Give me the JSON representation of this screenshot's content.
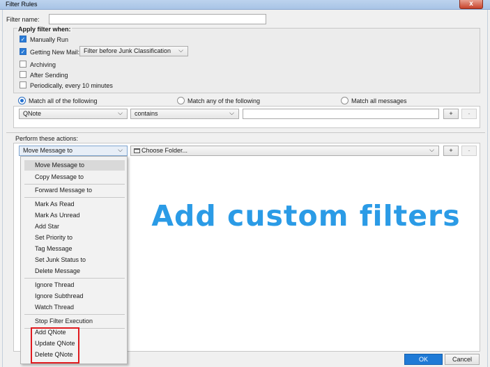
{
  "window": {
    "title": "Filter Rules",
    "close_glyph": "x"
  },
  "filter_name": {
    "label": "Filter name:",
    "mnemonic": "i",
    "value": ""
  },
  "apply_when": {
    "heading": "Apply filter when:",
    "manually_run": {
      "label": "Manually Run",
      "checked": true
    },
    "getting_new_mail": {
      "label": "Getting New Mail:",
      "checked": true,
      "timing": "Filter before Junk Classification"
    },
    "archiving": {
      "label": "Archiving",
      "checked": false
    },
    "after_sending": {
      "label": "After Sending",
      "checked": false
    },
    "periodically": {
      "label": "Periodically, every 10 minutes",
      "checked": false
    }
  },
  "match": {
    "all": "Match all of the following",
    "any": "Match any of the following",
    "all_messages": "Match all messages",
    "selected": "all"
  },
  "condition": {
    "field": "QNote",
    "operator": "contains",
    "value": "",
    "add": "+",
    "remove": "-"
  },
  "actions": {
    "label": "Perform these actions:",
    "action": "Move Message to",
    "target": "Choose Folder...",
    "add": "+",
    "remove": "-"
  },
  "action_menu": {
    "items": [
      "Move Message to",
      "Copy Message to",
      "Forward Message to",
      "Mark As Read",
      "Mark As Unread",
      "Add Star",
      "Set Priority to",
      "Tag Message",
      "Set Junk Status to",
      "Delete Message",
      "Ignore Thread",
      "Ignore Subthread",
      "Watch Thread",
      "Stop Filter Execution",
      "Add QNote",
      "Update QNote",
      "Delete QNote"
    ],
    "highlighted": "Move Message to"
  },
  "banner": "Add custom filters",
  "buttons": {
    "ok": "OK",
    "cancel": "Cancel"
  },
  "icons": {
    "check": "check-icon",
    "chevron": "chevron-down-icon",
    "folder": "folder-icon"
  },
  "colors": {
    "accent": "#1f7ad6",
    "banner": "#2b9be6",
    "highlight_box": "#e0191e"
  }
}
